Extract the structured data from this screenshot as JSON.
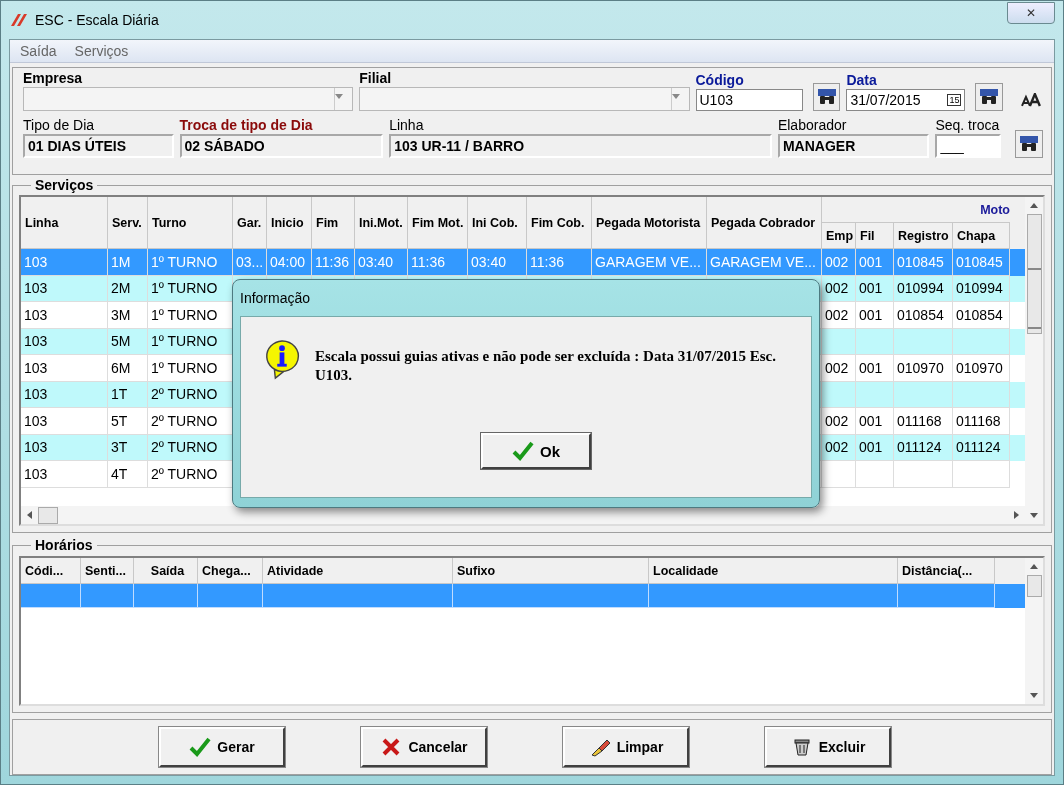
{
  "window": {
    "title": "ESC - Escala Diária",
    "close": "✕"
  },
  "menu": [
    {
      "label": "Saída"
    },
    {
      "label": "Serviços"
    }
  ],
  "form": {
    "empresa": {
      "label": "Empresa"
    },
    "filial": {
      "label": "Filial"
    },
    "codigo": {
      "label": "Código",
      "value": "U103"
    },
    "data": {
      "label": "Data",
      "value": "31/07/2015",
      "calendar": "15"
    },
    "tipo_dia": {
      "label": "Tipo de Dia",
      "value": "01 DIAS ÚTEIS"
    },
    "troca": {
      "label": "Troca de tipo de Dia",
      "value": "02 SÁBADO"
    },
    "linha": {
      "label": "Linha",
      "value": "103 UR-11 / BARRO"
    },
    "elaborador": {
      "label": "Elaborador",
      "value": "MANAGER"
    },
    "seq_troca": {
      "label": "Seq. troca",
      "value": "___"
    }
  },
  "servicos": {
    "title": "Serviços",
    "columns": [
      "Linha",
      "Serv.",
      "Turno",
      "Gar.",
      "Inicio",
      "Fim",
      "Ini.Mot.",
      "Fim Mot.",
      "Ini Cob.",
      "Fim Cob.",
      "Pegada Motorista",
      "Pegada Cobrador"
    ],
    "group": "Moto",
    "group_columns": [
      "Emp",
      "Fil",
      "Registro",
      "Chapa"
    ],
    "rows": [
      {
        "selected": true,
        "linha": "103",
        "serv": "1M",
        "turno": "1º TURNO",
        "gar": "03...",
        "inicio": "04:00",
        "fim": "11:36",
        "ini_mot": "03:40",
        "fim_mot": "11:36",
        "ini_cob": "03:40",
        "fim_cob": "11:36",
        "peg_mot": "GARAGEM VE...",
        "peg_cob": "GARAGEM VE...",
        "emp": "002",
        "fil": "001",
        "registro": "010845",
        "chapa": "010845"
      },
      {
        "selected": false,
        "linha": "103",
        "serv": "2M",
        "turno": "1º TURNO",
        "emp": "002",
        "fil": "001",
        "registro": "010994",
        "chapa": "010994"
      },
      {
        "selected": false,
        "linha": "103",
        "serv": "3M",
        "turno": "1º TURNO",
        "emp": "002",
        "fil": "001",
        "registro": "010854",
        "chapa": "010854"
      },
      {
        "selected": false,
        "linha": "103",
        "serv": "5M",
        "turno": "1º TURNO"
      },
      {
        "selected": false,
        "linha": "103",
        "serv": "6M",
        "turno": "1º TURNO",
        "emp": "002",
        "fil": "001",
        "registro": "010970",
        "chapa": "010970"
      },
      {
        "selected": false,
        "linha": "103",
        "serv": "1T",
        "turno": "2º TURNO"
      },
      {
        "selected": false,
        "linha": "103",
        "serv": "5T",
        "turno": "2º TURNO",
        "emp": "002",
        "fil": "001",
        "registro": "011168",
        "chapa": "011168"
      },
      {
        "selected": false,
        "linha": "103",
        "serv": "3T",
        "turno": "2º TURNO",
        "emp": "002",
        "fil": "001",
        "registro": "011124",
        "chapa": "011124"
      },
      {
        "selected": false,
        "linha": "103",
        "serv": "4T",
        "turno": "2º TURNO"
      }
    ]
  },
  "horarios": {
    "title": "Horários",
    "columns": [
      "Códi...",
      "Senti...",
      "Saída",
      "Chega...",
      "Atividade",
      "Sufixo",
      "Localidade",
      "Distância(..."
    ],
    "rows": [
      {
        "selected": true
      }
    ]
  },
  "buttons": [
    {
      "kind": "gerar",
      "label": "Gerar"
    },
    {
      "kind": "cancelar",
      "label": "Cancelar"
    },
    {
      "kind": "limpar",
      "label": "Limpar"
    },
    {
      "kind": "excluir",
      "label": "Excluir"
    }
  ],
  "dialog": {
    "title": "Informação",
    "message": "Escala possui guias ativas e não pode ser excluída : Data 31/07/2015 Esc. U103.",
    "button": "Ok"
  }
}
